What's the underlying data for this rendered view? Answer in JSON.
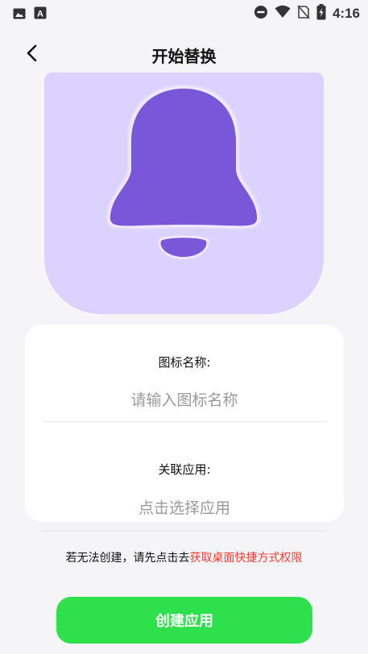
{
  "status_bar": {
    "time": "4:16",
    "left_icons": [
      "image-icon",
      "a-icon"
    ],
    "right_icons": [
      "do-not-disturb-icon",
      "wifi-icon",
      "no-sim-icon",
      "battery-icon"
    ]
  },
  "header": {
    "title": "开始替换",
    "back_icon": "chevron-left-icon"
  },
  "preview": {
    "icon": "bell-icon",
    "background_color": "#dcd2ff",
    "bell_color": "#7a57d9"
  },
  "form": {
    "icon_name_label": "图标名称:",
    "icon_name_placeholder": "请输入图标名称",
    "icon_name_value": "",
    "app_label": "关联应用:",
    "app_placeholder": "点击选择应用"
  },
  "notice": {
    "prefix": "若无法创建，请先点击去",
    "link": "获取桌面快捷方式权限",
    "link_color": "#ff3b30"
  },
  "actions": {
    "create_label": "创建应用",
    "button_color": "#2ee04c"
  }
}
